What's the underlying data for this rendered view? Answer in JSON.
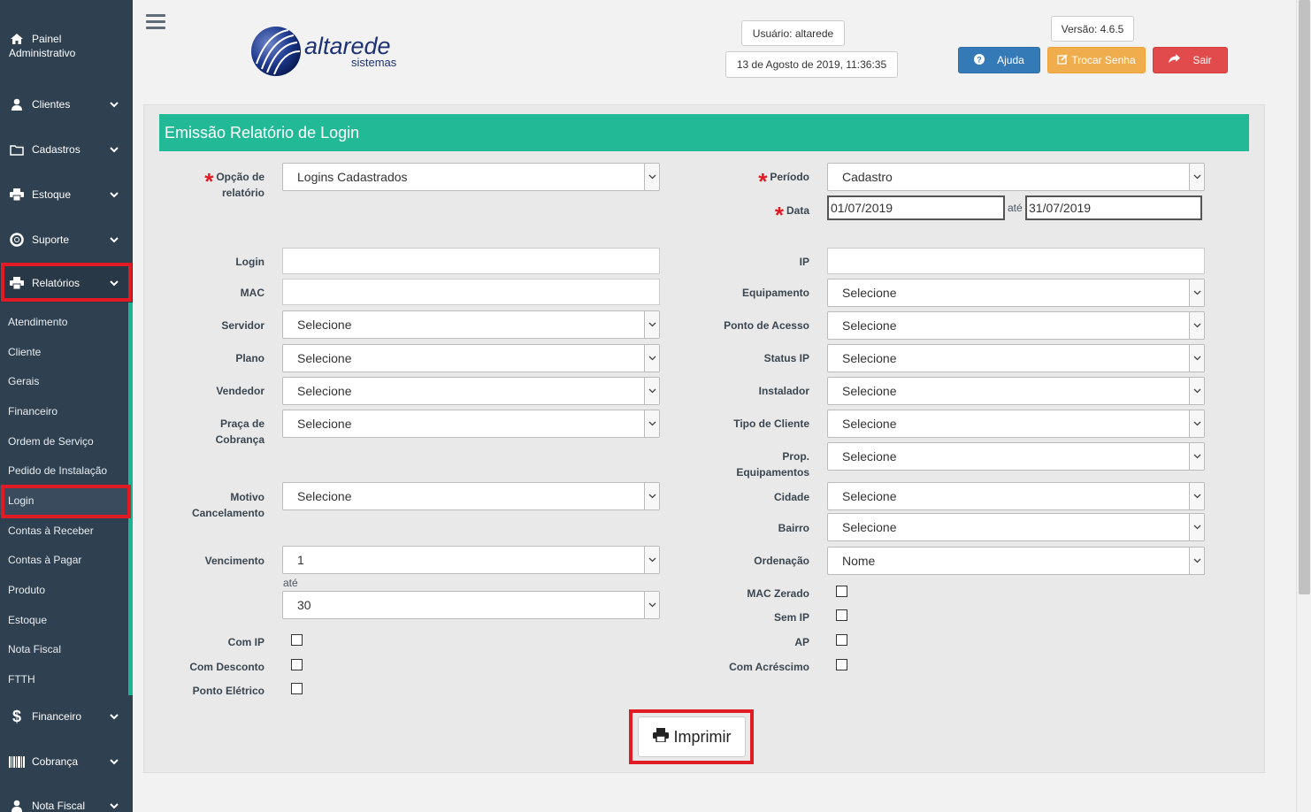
{
  "sidebar": {
    "painel_line1": "Painel",
    "painel_line2": "Administrativo",
    "items": {
      "clientes": "Clientes",
      "cadastros": "Cadastros",
      "estoque": "Estoque",
      "suporte": "Suporte",
      "relatorios": "Relatórios",
      "financeiro": "Financeiro",
      "cobranca": "Cobrança",
      "nota_fiscal": "Nota Fiscal"
    },
    "submenu": [
      "Atendimento",
      "Cliente",
      "Gerais",
      "Financeiro",
      "Ordem de Serviço",
      "Pedido de Instalação",
      "Login",
      "Contas à Receber",
      "Contas à Pagar",
      "Produto",
      "Estoque",
      "Nota Fiscal",
      "FTTH"
    ],
    "active_submenu": "Login"
  },
  "header": {
    "logo_main": "altarede",
    "logo_sub": "sistemas",
    "user": "Usuário: altarede",
    "datetime": "13 de Agosto de 2019, 11:36:35",
    "version": "Versão: 4.6.5",
    "btn_ajuda": "Ajuda",
    "btn_senha": "Trocar Senha",
    "btn_sair": "Sair"
  },
  "form": {
    "title": "Emissão Relatório de Login",
    "opcao_label_1": "Opção de",
    "opcao_label_2": "relatório",
    "opcao_value": "Logins Cadastrados",
    "periodo_label": "Período",
    "periodo_value": "Cadastro",
    "data_label": "Data",
    "data_from": "01/07/2019",
    "ate": "até",
    "data_to": "31/07/2019",
    "login_label": "Login",
    "ip_label": "IP",
    "mac_label": "MAC",
    "equipamento_label": "Equipamento",
    "servidor_label": "Servidor",
    "ponto_acesso_label": "Ponto de Acesso",
    "plano_label": "Plano",
    "status_ip_label": "Status IP",
    "vendedor_label": "Vendedor",
    "instalador_label": "Instalador",
    "praca_label_1": "Praça de",
    "praca_label_2": "Cobrança",
    "tipo_cliente_label": "Tipo de Cliente",
    "prop_label_1": "Prop.",
    "prop_label_2": "Equipamentos",
    "motivo_label_1": "Motivo",
    "motivo_label_2": "Cancelamento",
    "cidade_label": "Cidade",
    "bairro_label": "Bairro",
    "vencimento_label": "Vencimento",
    "vencimento_from": "1",
    "vencimento_to": "30",
    "ordenacao_label": "Ordenação",
    "ordenacao_value": "Nome",
    "selecione": "Selecione",
    "mac_zerado_label": "MAC Zerado",
    "sem_ip_label": "Sem IP",
    "ap_label": "AP",
    "com_acrescimo_label": "Com Acréscimo",
    "com_ip_label": "Com IP",
    "com_desconto_label": "Com Desconto",
    "ponto_eletrico_label": "Ponto Elétrico",
    "print_button": "Imprimir"
  },
  "colors": {
    "sidebar_bg": "#2f4050",
    "header_green": "#22b997",
    "highlight_red": "#e01b24",
    "btn_blue": "#337ab7",
    "btn_orange": "#f0ad4e",
    "btn_red": "#e24b4b"
  }
}
